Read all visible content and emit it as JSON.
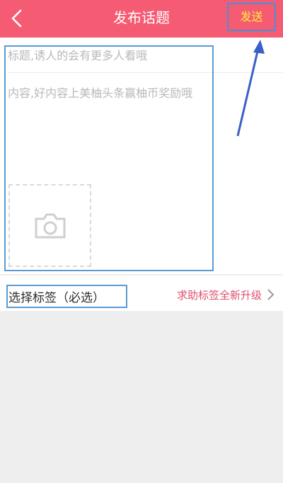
{
  "header": {
    "title": "发布话题",
    "send_label": "发送",
    "back_icon": "chevron-left-icon"
  },
  "form": {
    "title_placeholder": "标题,诱人的会有更多人看哦",
    "content_placeholder": "内容,好内容上美柚头条赢柚币奖励哦",
    "add_photo_icon": "camera-icon"
  },
  "tags": {
    "select_label": "选择标签（必选）",
    "upgrade_link": "求助标签全新升级",
    "chevron_icon": "chevron-right-icon"
  },
  "colors": {
    "header_bg": "#f55b72",
    "send_text": "#ffee3a",
    "annotation": "#5b9bd5",
    "arrow": "#3a5fc8",
    "link": "#e0506d"
  }
}
